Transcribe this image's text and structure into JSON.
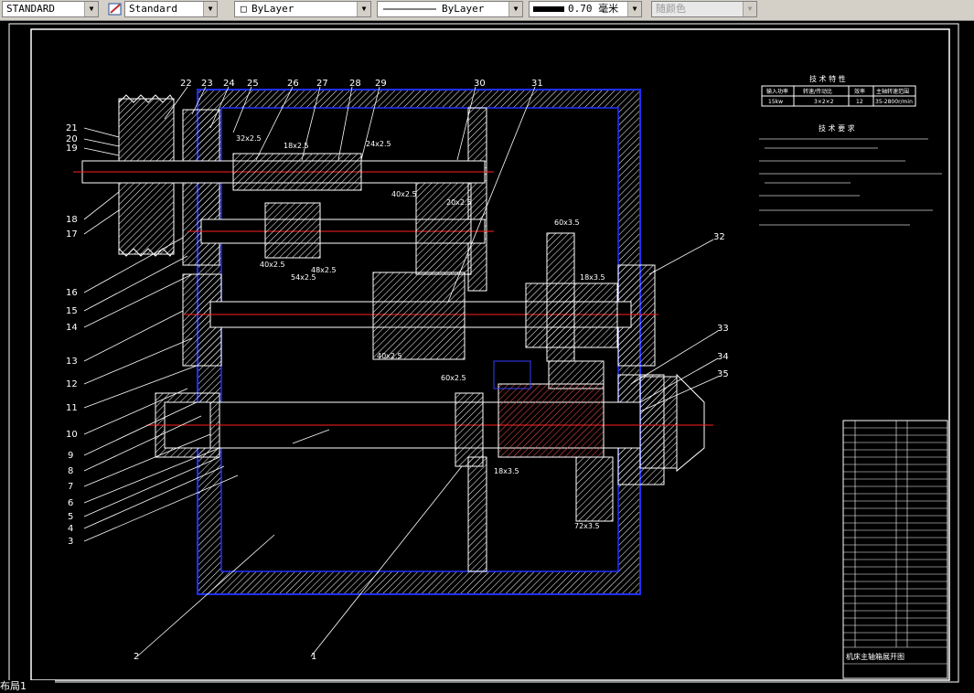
{
  "toolbar": {
    "text_style": "STANDARD",
    "dim_style": "Standard",
    "layer": "ByLayer",
    "linetype": "ByLayer",
    "lineweight": "0.70 毫米",
    "color": "随颜色"
  },
  "drawing": {
    "tech_spec_title": "技 术 特 性",
    "tech_spec_headers": [
      "输入功率",
      "转速/传动比",
      "效率",
      "主轴转速范围"
    ],
    "tech_spec_values": [
      "15kw",
      "3×2×2",
      "12",
      "35-2800r/min"
    ],
    "tech_req_title": "技 术 要 求",
    "balloons": [
      "1",
      "2",
      "3",
      "4",
      "5",
      "6",
      "7",
      "8",
      "9",
      "10",
      "11",
      "12",
      "13",
      "14",
      "15",
      "16",
      "17",
      "18",
      "19",
      "20",
      "21",
      "22",
      "23",
      "24",
      "25",
      "26",
      "27",
      "28",
      "29",
      "30",
      "31",
      "32",
      "33",
      "34",
      "35"
    ],
    "gear_labels": [
      "32x2.5",
      "18x2.5",
      "24x2.5",
      "40x2.5",
      "20x2.5",
      "60x3.5",
      "40x2.5",
      "54x2.5",
      "48x2.5",
      "18x3.5",
      "40x2.5",
      "60x2.5",
      "18x3.5",
      "72x3.5"
    ],
    "title_block_title": "机床主轴箱展开图"
  },
  "status": {
    "layout_tab": "布局1"
  }
}
